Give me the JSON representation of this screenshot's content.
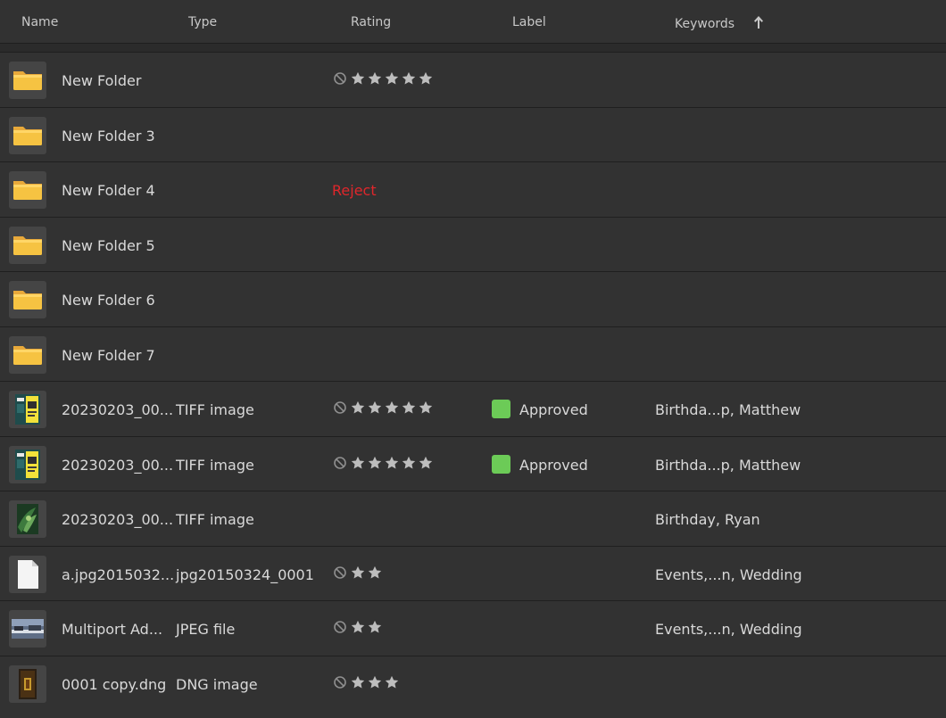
{
  "columns": {
    "name": "Name",
    "type": "Type",
    "rating": "Rating",
    "label": "Label",
    "keywords": "Keywords"
  },
  "sort": {
    "column": "keywords",
    "direction": "ascending",
    "icon": "arrow-up-icon"
  },
  "colors": {
    "reject": "#e0262b",
    "approved": "#6ccb57",
    "folder": "#f6c342"
  },
  "rows": [
    {
      "name": "New Folder",
      "type": "",
      "thumb": "folder",
      "rating": 0,
      "show_rating": true,
      "reject": false,
      "label": "",
      "keywords": ""
    },
    {
      "name": "New Folder 3",
      "type": "",
      "thumb": "folder",
      "rating": 0,
      "show_rating": false,
      "reject": false,
      "label": "",
      "keywords": ""
    },
    {
      "name": "New Folder 4",
      "type": "",
      "thumb": "folder",
      "rating": 0,
      "show_rating": false,
      "reject": true,
      "reject_text": "Reject",
      "label": "",
      "keywords": ""
    },
    {
      "name": "New Folder 5",
      "type": "",
      "thumb": "folder",
      "rating": 0,
      "show_rating": false,
      "reject": false,
      "label": "",
      "keywords": ""
    },
    {
      "name": "New Folder 6",
      "type": "",
      "thumb": "folder",
      "rating": 0,
      "show_rating": false,
      "reject": false,
      "label": "",
      "keywords": ""
    },
    {
      "name": "New Folder 7",
      "type": "",
      "thumb": "folder",
      "rating": 0,
      "show_rating": false,
      "reject": false,
      "label": "",
      "keywords": ""
    },
    {
      "name": "20230203_00...",
      "type": "TIFF image",
      "thumb": "poster",
      "rating": 0,
      "show_rating": true,
      "reject": false,
      "label": "Approved",
      "keywords": "Birthda...p, Matthew"
    },
    {
      "name": "20230203_00...",
      "type": "TIFF image",
      "thumb": "poster",
      "rating": 0,
      "show_rating": true,
      "reject": false,
      "label": "Approved",
      "keywords": "Birthda...p, Matthew"
    },
    {
      "name": "20230203_00...",
      "type": "TIFF image",
      "thumb": "green",
      "rating": 0,
      "show_rating": false,
      "reject": false,
      "label": "",
      "keywords": "Birthday, Ryan"
    },
    {
      "name": "a.jpg2015032...",
      "type": "jpg20150324_0001",
      "thumb": "file",
      "rating": 2,
      "show_rating": true,
      "reject": false,
      "label": "",
      "keywords": "Events,...n, Wedding"
    },
    {
      "name": "Multiport Ad...",
      "type": "JPEG file",
      "thumb": "photo",
      "rating": 2,
      "show_rating": true,
      "reject": false,
      "label": "",
      "keywords": "Events,...n, Wedding"
    },
    {
      "name": "0001 copy.dng",
      "type": "DNG image",
      "thumb": "dark",
      "rating": 3,
      "show_rating": true,
      "reject": false,
      "label": "",
      "keywords": ""
    }
  ]
}
